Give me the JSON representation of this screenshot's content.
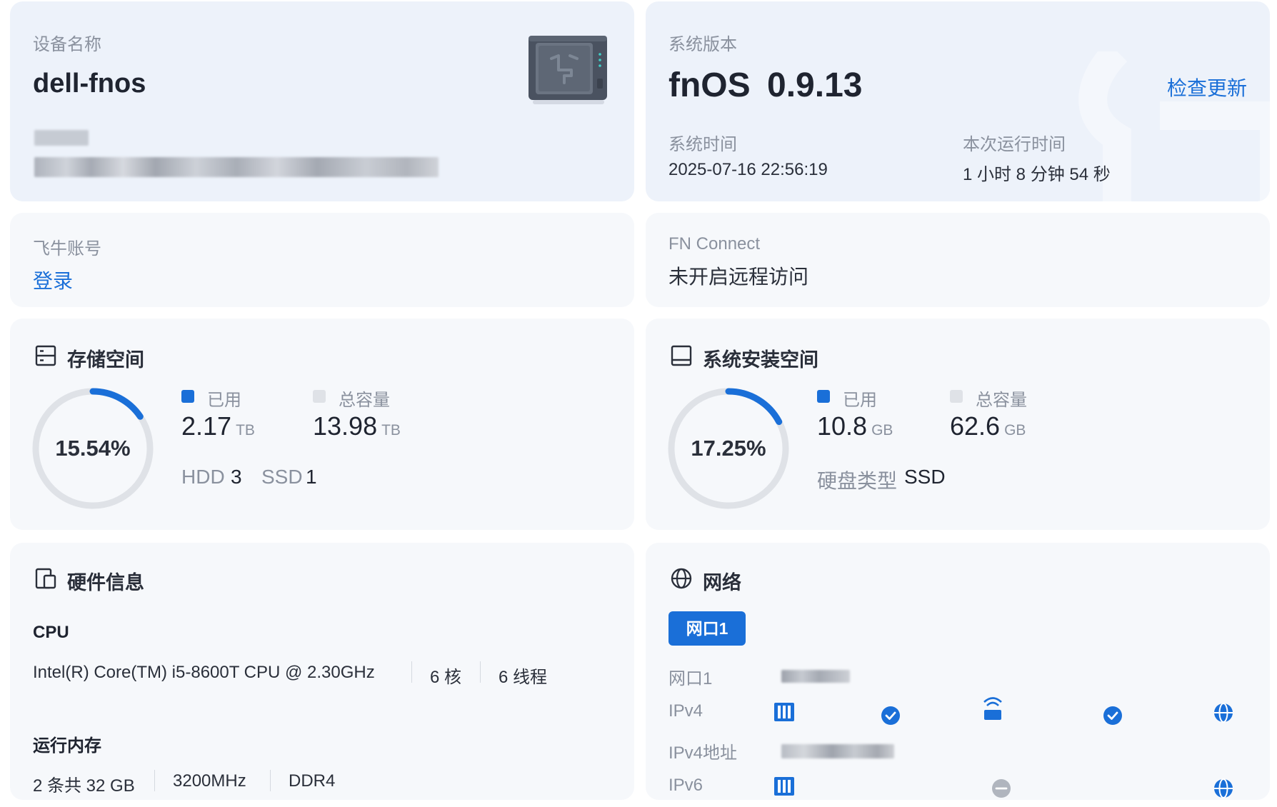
{
  "device": {
    "label": "设备名称",
    "name": "dell-fnos"
  },
  "system": {
    "version_label": "系统版本",
    "os_name": "fnOS",
    "os_version": "0.9.13",
    "check_update": "检查更新",
    "time_label": "系统时间",
    "time_value": "2025-07-16 22:56:19",
    "uptime_label": "本次运行时间",
    "uptime_value": "1 小时 8 分钟 54 秒"
  },
  "account": {
    "label": "飞牛账号",
    "login": "登录"
  },
  "connect": {
    "label": "FN Connect",
    "status": "未开启远程访问"
  },
  "storage": {
    "title": "存储空间",
    "percent": "15.54%",
    "percent_value": 15.54,
    "used_label": "已用",
    "used_value": "2.17",
    "used_unit": "TB",
    "total_label": "总容量",
    "total_value": "13.98",
    "total_unit": "TB",
    "hdd_label": "HDD",
    "hdd_count": "3",
    "ssd_label": "SSD",
    "ssd_count": "1"
  },
  "sysdisk": {
    "title": "系统安装空间",
    "percent": "17.25%",
    "percent_value": 17.25,
    "used_label": "已用",
    "used_value": "10.8",
    "used_unit": "GB",
    "total_label": "总容量",
    "total_value": "62.6",
    "total_unit": "GB",
    "type_label": "硬盘类型",
    "type_value": "SSD"
  },
  "hardware": {
    "title": "硬件信息",
    "cpu_label": "CPU",
    "cpu_model": "Intel(R) Core(TM) i5-8600T CPU @ 2.30GHz",
    "cpu_cores": "6 核",
    "cpu_threads": "6 线程",
    "mem_label": "运行内存",
    "mem_size": "2 条共 32 GB",
    "mem_speed": "3200MHz",
    "mem_type": "DDR4"
  },
  "network": {
    "title": "网络",
    "tab": "网口1",
    "port_label": "网口1",
    "ipv4_label": "IPv4",
    "ipv4_addr_label": "IPv4地址",
    "ipv6_label": "IPv6"
  },
  "colors": {
    "accent": "#1a6fd8",
    "ring_track": "#dfe2e7",
    "card_highlight": "#edf2fa",
    "card_plain": "#f6f8fb"
  }
}
